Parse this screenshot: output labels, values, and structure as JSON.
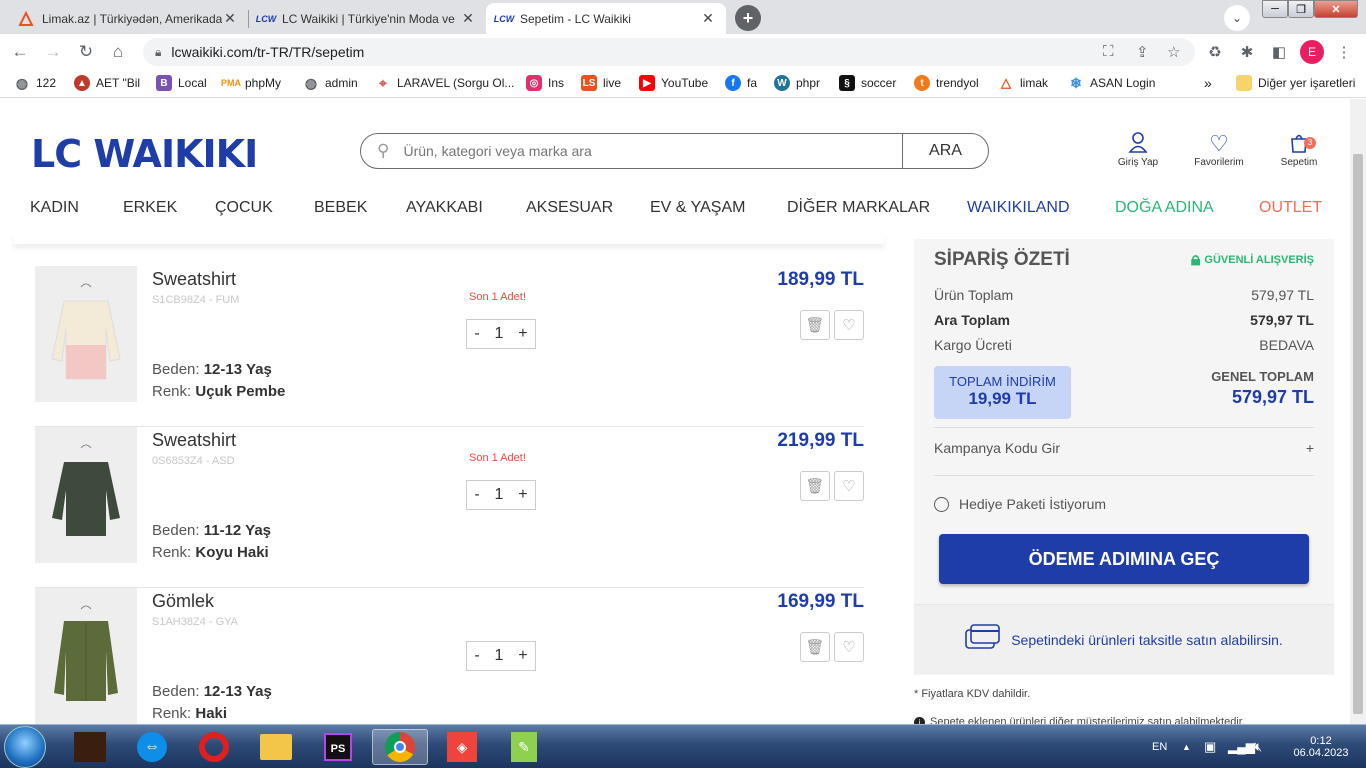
{
  "browser": {
    "tabs": [
      {
        "title": "Limak.az | Türkiyədən, Amerikada",
        "favicon": "limak-icon",
        "active": false
      },
      {
        "title": "LC Waikiki | Türkiye'nin Moda ve",
        "favicon": "lcw-icon",
        "active": false
      },
      {
        "title": "Sepetim - LC Waikiki",
        "favicon": "lcw-icon",
        "active": true
      }
    ],
    "favicon_text": "LCW",
    "url": "lcwaikiki.com/tr-TR/TR/sepetim",
    "profile_initial": "E",
    "bookmarks": [
      {
        "label": "122",
        "icon": "globe-icon",
        "color": "#5f6368"
      },
      {
        "label": "AET \"Bil",
        "icon": "aet-icon",
        "color": "#c0392b"
      },
      {
        "label": "Local",
        "icon": "bootstrap-icon",
        "color": "#7952b3"
      },
      {
        "label": "phpMy",
        "icon": "phpmyadmin-icon",
        "color": "#f29111"
      },
      {
        "label": "admin",
        "icon": "globe-icon",
        "color": "#5f6368"
      },
      {
        "label": "LARAVEL (Sorgu Ol...",
        "icon": "pin-icon",
        "color": "#d9534f"
      },
      {
        "label": "Ins",
        "icon": "instagram-icon",
        "color": "#e1306c"
      },
      {
        "label": "live",
        "icon": "ls-icon",
        "color": "#e8541c"
      },
      {
        "label": "YouTube",
        "icon": "youtube-icon",
        "color": "#ff0000"
      },
      {
        "label": "fa",
        "icon": "facebook-icon",
        "color": "#1877f2"
      },
      {
        "label": "phpr",
        "icon": "wordpress-icon",
        "color": "#21759b"
      },
      {
        "label": "soccer",
        "icon": "soccer-icon",
        "color": "#111111"
      },
      {
        "label": "trendyol",
        "icon": "trendyol-icon",
        "color": "#f27a1a"
      },
      {
        "label": "limak",
        "icon": "limak-icon",
        "color": "#e8541c"
      },
      {
        "label": "ASAN Login",
        "icon": "asan-icon",
        "color": "#3a8fd6"
      }
    ],
    "more_bookmarks": "»",
    "other_bookmarks": "Diğer yer işaretleri"
  },
  "site": {
    "logo": "LC WAIKIKI",
    "search_placeholder": "Ürün, kategori veya marka ara",
    "search_button": "ARA",
    "header_icons": [
      {
        "label": "Giriş Yap",
        "icon": "user-icon"
      },
      {
        "label": "Favorilerim",
        "icon": "heart-icon"
      },
      {
        "label": "Sepetim",
        "icon": "cart-icon",
        "badge": "3"
      }
    ],
    "menu": [
      {
        "label": "KADIN",
        "color": "#333333"
      },
      {
        "label": "ERKEK",
        "color": "#333333"
      },
      {
        "label": "ÇOCUK",
        "color": "#333333"
      },
      {
        "label": "BEBEK",
        "color": "#333333"
      },
      {
        "label": "AYAKKABI",
        "color": "#333333"
      },
      {
        "label": "AKSESUAR",
        "color": "#333333"
      },
      {
        "label": "EV & YAŞAM",
        "color": "#333333"
      },
      {
        "label": "DİĞER MARKALAR",
        "color": "#333333"
      },
      {
        "label": "WAIKIKILAND",
        "color": "#1e3da8"
      },
      {
        "label": "DOĞA ADINA",
        "color": "#2bb673"
      },
      {
        "label": "OUTLET",
        "color": "#f06e5a"
      }
    ]
  },
  "cart": {
    "items": [
      {
        "name": "Sweatshirt",
        "code": "S1CB98Z4 - FUM",
        "stock": "Son 1 Adet!",
        "qty": "1",
        "price": "189,99 TL",
        "size_label": "Beden:",
        "size": "12-13 Yaş",
        "color_label": "Renk:",
        "color": "Uçuk Pembe",
        "image": "pink-sweatshirt-image"
      },
      {
        "name": "Sweatshirt",
        "code": "0S6853Z4 - ASD",
        "stock": "Son 1 Adet!",
        "qty": "1",
        "price": "219,99 TL",
        "size_label": "Beden:",
        "size": "11-12 Yaş",
        "color_label": "Renk:",
        "color": "Koyu Haki",
        "image": "khaki-sweatshirt-image"
      },
      {
        "name": "Gömlek",
        "code": "S1AH38Z4 - GYA",
        "stock": "",
        "qty": "1",
        "price": "169,99 TL",
        "size_label": "Beden:",
        "size": "12-13 Yaş",
        "color_label": "Renk:",
        "color": "Haki",
        "image": "khaki-shirt-image"
      }
    ],
    "minus": "-",
    "plus": "+"
  },
  "summary": {
    "title": "SİPARİŞ ÖZETİ",
    "secure": "GÜVENLİ ALIŞVERİŞ",
    "rows": [
      {
        "label": "Ürün Toplam",
        "value": "579,97 TL"
      },
      {
        "label": "Ara Toplam",
        "value": "579,97 TL"
      },
      {
        "label": "Kargo Ücreti",
        "value": "BEDAVA"
      }
    ],
    "discount_label": "TOPLAM İNDİRİM",
    "discount_value": "19,99 TL",
    "grand_label": "GENEL TOPLAM",
    "grand_value": "579,97 TL",
    "campaign": "Kampanya Kodu Gir",
    "campaign_toggle": "+",
    "gift": "Hediye Paketi İstiyorum",
    "pay_button": "ÖDEME ADIMINA GEÇ",
    "installment": "Sepetindeki ürünleri taksitle satın alabilirsin.",
    "vat_note": "* Fiyatlara KDV dahildir.",
    "info_note": "Sepete eklenen ürünleri diğer müşterilerimiz satın alabilmektedir."
  },
  "taskbar": {
    "lang": "EN",
    "time": "0:12",
    "date": "06.04.2023"
  }
}
